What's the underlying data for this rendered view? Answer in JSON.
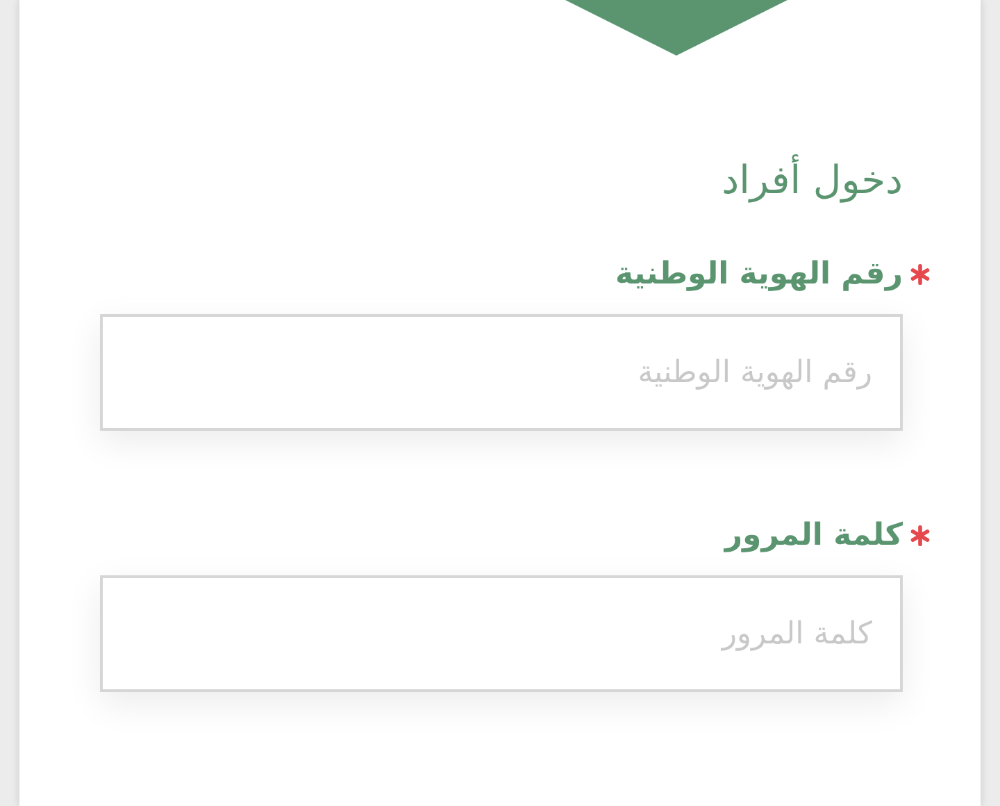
{
  "title": "دخول أفراد",
  "fields": [
    {
      "label": "رقم الهوية الوطنية",
      "required": true,
      "placeholder": "رقم الهوية الوطنية"
    },
    {
      "label": "كلمة المرور",
      "required": true,
      "placeholder": "كلمة المرور"
    }
  ]
}
